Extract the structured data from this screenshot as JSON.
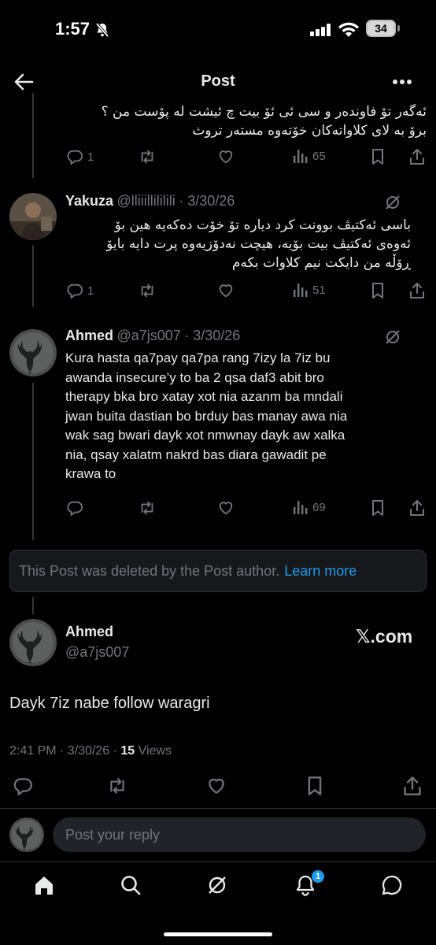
{
  "status_bar": {
    "time": "1:57",
    "battery": "34"
  },
  "header": {
    "title": "Post"
  },
  "posts": [
    {
      "text_lines": [
        "ئەگەر تۆ فاوندەر و سی ئی ئۆ بیت چ ئیشت لە پۆست من ؟",
        "برۆ بە لای کلاواتەکان خۆتەوە مستەر تروث"
      ],
      "replies": "1",
      "views": "65"
    },
    {
      "name": "Yakuza",
      "handle": "@lliiillililili",
      "date": "· 3/30/26",
      "text_lines": [
        "باسی ئەکتیڤ بوونت کرد دیارە تۆ خۆت دەکەیە هین بۆ",
        "ئەوەی ئەکتیڤ بیت بۆیە، هیچت نەدۆزیەوە پرت دایە بایۆ",
        "ڕۆڵە من دایکت نیم کلاوات بکەم"
      ],
      "replies": "1",
      "views": "51"
    },
    {
      "name": "Ahmed",
      "handle": "@a7js007",
      "date": "· 3/30/26",
      "text_lines": [
        "Kura hasta qa7pay qa7pa rang 7izy la 7iz bu",
        "awanda insecure’y to ba 2 qsa daf3 abit bro",
        "therapy bka bro xatay xot nia azanm ba mndali",
        "jwan buita dastian bo brduy bas manay awa nia",
        "wak sag  bwari dayk xot nmwnay dayk aw xalka",
        "nia, qsay xalatm nakrd bas diara gawadit pe",
        "krawa to"
      ],
      "views": "69"
    }
  ],
  "deleted_notice": {
    "text": "This Post was deleted by the Post author.",
    "link": "Learn more"
  },
  "main_post": {
    "name": "Ahmed",
    "handle": "@a7js007",
    "source": "𝕏.com",
    "text": "Dayk 7iz nabe follow waragri",
    "time": "2:41 PM · 3/30/26 · ",
    "views_count": "15",
    "views_label": " Views"
  },
  "reply": {
    "placeholder": "Post your reply"
  },
  "nav": {
    "notifications_badge": "1"
  },
  "colors": {
    "accent": "#1d9bf0",
    "background": "#000000",
    "muted": "#71767b"
  }
}
